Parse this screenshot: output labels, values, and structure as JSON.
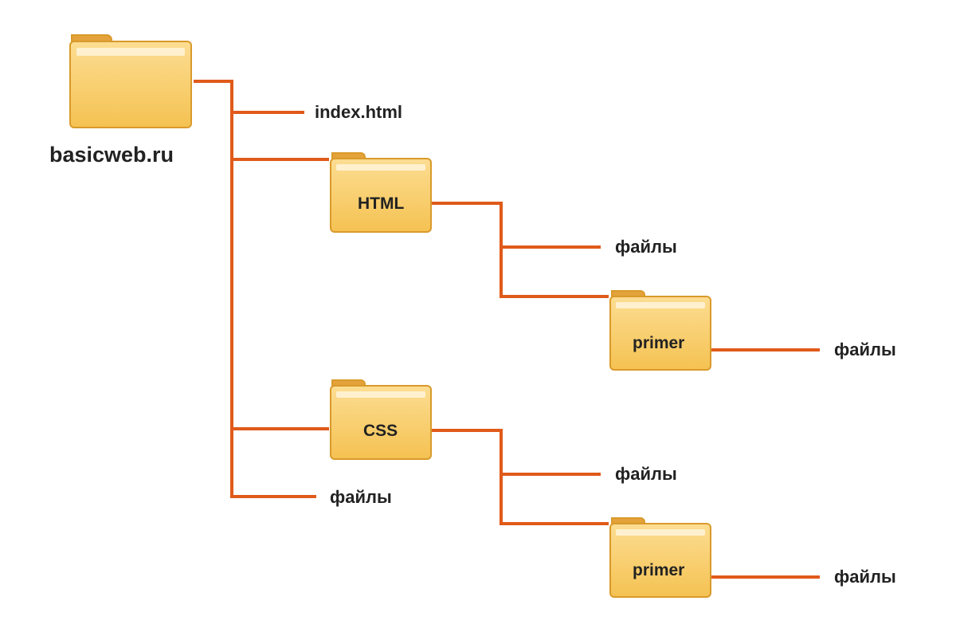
{
  "colors": {
    "line": "#e05a1a",
    "folder_body_light": "#fcd989",
    "folder_body_dark": "#f6c55c",
    "folder_stroke": "#d99a2b",
    "folder_tab": "#e3a23a"
  },
  "root": {
    "label": "basicweb.ru"
  },
  "level1": {
    "index": "index.html",
    "html_folder": "HTML",
    "css_folder": "CSS",
    "files": "файлы"
  },
  "level2": {
    "html_files": "файлы",
    "html_primer": "primer",
    "css_files": "файлы",
    "css_primer": "primer"
  },
  "level3": {
    "html_primer_files": "файлы",
    "css_primer_files": "файлы"
  }
}
